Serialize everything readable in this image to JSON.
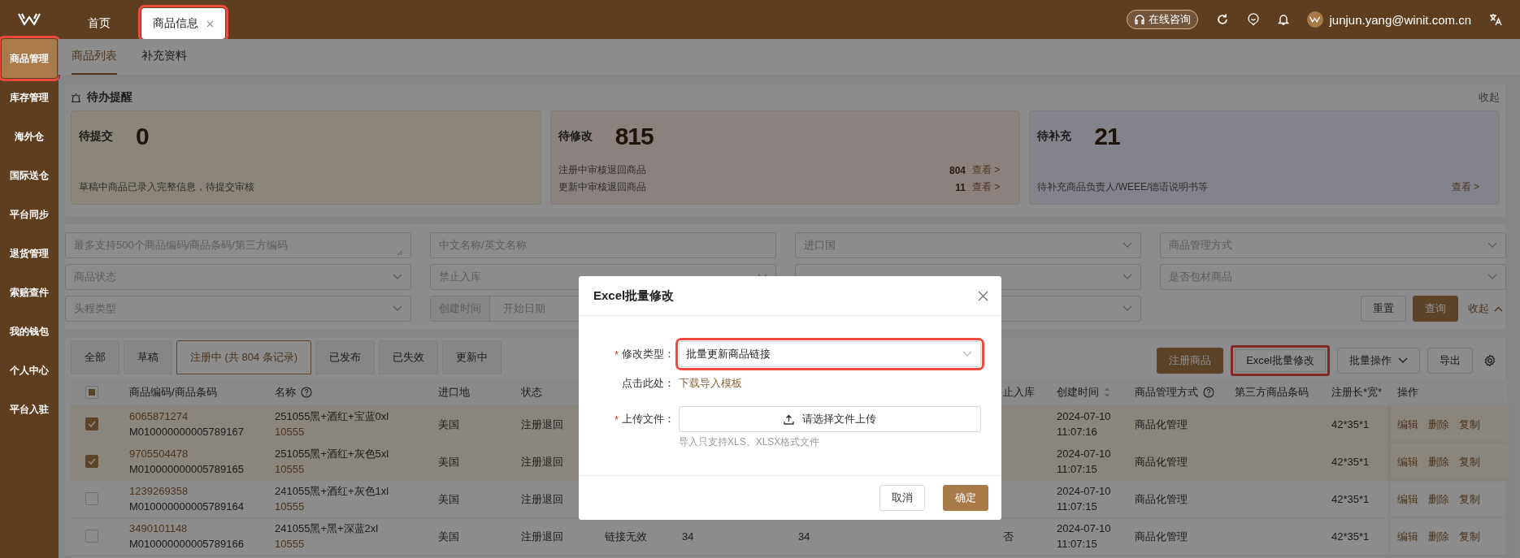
{
  "topbar": {
    "tabs": [
      {
        "label": "首页",
        "selected": false,
        "closable": false,
        "highlighted": false
      },
      {
        "label": "商品信息",
        "selected": true,
        "closable": true,
        "highlighted": true
      }
    ],
    "consult_button": "在线咨询",
    "user": "junjun.yang@winit.com.cn"
  },
  "sidebar": {
    "items": [
      {
        "label": "商品管理",
        "selected": true,
        "highlighted": true
      },
      {
        "label": "库存管理",
        "selected": false,
        "highlighted": false
      },
      {
        "label": "海外仓",
        "selected": false,
        "highlighted": false
      },
      {
        "label": "国际送仓",
        "selected": false,
        "highlighted": false
      },
      {
        "label": "平台同步",
        "selected": false,
        "highlighted": false
      },
      {
        "label": "退货管理",
        "selected": false,
        "highlighted": false
      },
      {
        "label": "索赔查件",
        "selected": false,
        "highlighted": false
      },
      {
        "label": "我的钱包",
        "selected": false,
        "highlighted": false
      },
      {
        "label": "个人中心",
        "selected": false,
        "highlighted": false
      },
      {
        "label": "平台入驻",
        "selected": false,
        "highlighted": false
      }
    ]
  },
  "subtabs": [
    {
      "label": "商品列表",
      "selected": true
    },
    {
      "label": "补充资料",
      "selected": false
    }
  ],
  "todo": {
    "title": "待办提醒",
    "collapse": "收起",
    "cards": [
      {
        "title": "待提交",
        "count": "0",
        "lines": [
          {
            "text": "草稿中商品已录入完整信息，待提交审核"
          }
        ]
      },
      {
        "title": "待修改",
        "count": "815",
        "lines": [
          {
            "text": "注册中审核退回商品",
            "value": "804",
            "link": "查看 >"
          },
          {
            "text": "更新中审核退回商品",
            "value": "11",
            "link": "查看 >"
          }
        ]
      },
      {
        "title": "待补充",
        "count": "21",
        "lines": [
          {
            "text": "待补充商品负责人/WEEE/德语说明书等",
            "link": "查看 >"
          }
        ]
      }
    ]
  },
  "filters": {
    "fields": [
      {
        "kind": "textarea",
        "placeholder": "最多支持500个商品编码/商品条码/第三方编码"
      },
      {
        "kind": "input",
        "placeholder": "中文名称/英文名称"
      },
      {
        "kind": "select",
        "placeholder": "进口国"
      },
      {
        "kind": "select",
        "placeholder": "商品管理方式"
      },
      {
        "kind": "select",
        "placeholder": "商品状态"
      },
      {
        "kind": "select",
        "placeholder": "禁止入库"
      },
      {
        "kind": "select"
      },
      {
        "kind": "select",
        "placeholder": "是否包材商品"
      },
      {
        "kind": "select",
        "placeholder": "头程类型"
      },
      {
        "kind": "daterange",
        "label": "创建时间",
        "placeholder": "开始日期"
      },
      {
        "kind": "select"
      }
    ],
    "reset": "重置",
    "search": "查询",
    "collapse": "收起"
  },
  "list": {
    "tabs": [
      {
        "label": "全部",
        "selected": false
      },
      {
        "label": "草稿",
        "selected": false
      },
      {
        "label": "注册中 (共 804 条记录)",
        "selected": true
      },
      {
        "label": "已发布",
        "selected": false
      },
      {
        "label": "已失效",
        "selected": false
      },
      {
        "label": "更新中",
        "selected": false
      }
    ],
    "actions": [
      {
        "kind": "primary",
        "label": "注册商品",
        "highlighted": false
      },
      {
        "kind": "default",
        "label": "Excel批量修改",
        "highlighted": true
      },
      {
        "kind": "dropdown",
        "label": "批量操作",
        "highlighted": false
      },
      {
        "kind": "default",
        "label": "导出",
        "highlighted": false
      }
    ]
  },
  "table": {
    "select_all": {
      "indeterminate": true
    },
    "columns": [
      {
        "label": "商品编码/商品条码"
      },
      {
        "label": "名称",
        "help": true
      },
      {
        "label": "进口地"
      },
      {
        "label": "状态"
      },
      {},
      {},
      {},
      {
        "label": "止入库"
      },
      {
        "label": "创建时间",
        "sortable": true
      },
      {
        "label": "商品管理方式",
        "help": true
      },
      {
        "label": "第三方商品条码"
      },
      {
        "label": "注册长*宽*"
      },
      {
        "label": "操作"
      }
    ],
    "rows": [
      {
        "selected": true,
        "code": "6065871274",
        "barcode": "M010000000005789167",
        "name": "251055黑+酒红+宝蓝0xl",
        "ref": "10555",
        "origin": "美国",
        "status": "注册退回",
        "created": "2024-07-10 11:07:16",
        "manage_mode": "商品化管理",
        "size": "42*35*1",
        "actions": [
          "编辑",
          "删除",
          "复制"
        ]
      },
      {
        "selected": true,
        "code": "9705504478",
        "barcode": "M010000000005789165",
        "name": "251055黑+酒红+灰色5xl",
        "ref": "10555",
        "origin": "美国",
        "status": "注册退回",
        "created": "2024-07-10 11:07:15",
        "manage_mode": "商品化管理",
        "size": "42*35*1",
        "actions": [
          "编辑",
          "删除",
          "复制"
        ]
      },
      {
        "selected": false,
        "code": "1239269358",
        "barcode": "M010000000005789164",
        "name": "241055黑+酒红+灰色1xl",
        "ref": "10555",
        "origin": "美国",
        "status": "注册退回",
        "created": "2024-07-10 11:07:15",
        "manage_mode": "商品化管理",
        "size": "42*35*1",
        "actions": [
          "编辑",
          "删除",
          "复制"
        ]
      },
      {
        "selected": false,
        "code": "3490101148",
        "barcode": "M010000000005789166",
        "name": "241055黑+黑+深蓝2xl",
        "ref": "10555",
        "origin": "美国",
        "status": "注册退回",
        "column_5": "链接无效",
        "column_6": "34",
        "column_7": "34",
        "ban_inbound": "否",
        "created": "2024-07-10 11:07:15",
        "manage_mode": "商品化管理",
        "size": "42*35*1",
        "actions": [
          "编辑",
          "删除",
          "复制"
        ]
      }
    ]
  },
  "modal": {
    "title": "Excel批量修改",
    "fields": [
      {
        "kind": "select",
        "required_mark": "*",
        "label": "修改类型：",
        "value": "批量更新商品链接",
        "highlighted": true
      },
      {
        "kind": "link",
        "label": "点击此处：",
        "link": "下载导入模板"
      },
      {
        "kind": "upload",
        "required_mark": "*",
        "label": "上传文件：",
        "button": "请选择文件上传",
        "hint": "导入只支持XLS、XLSX格式文件"
      }
    ],
    "cancel": "取消",
    "confirm": "确定"
  }
}
